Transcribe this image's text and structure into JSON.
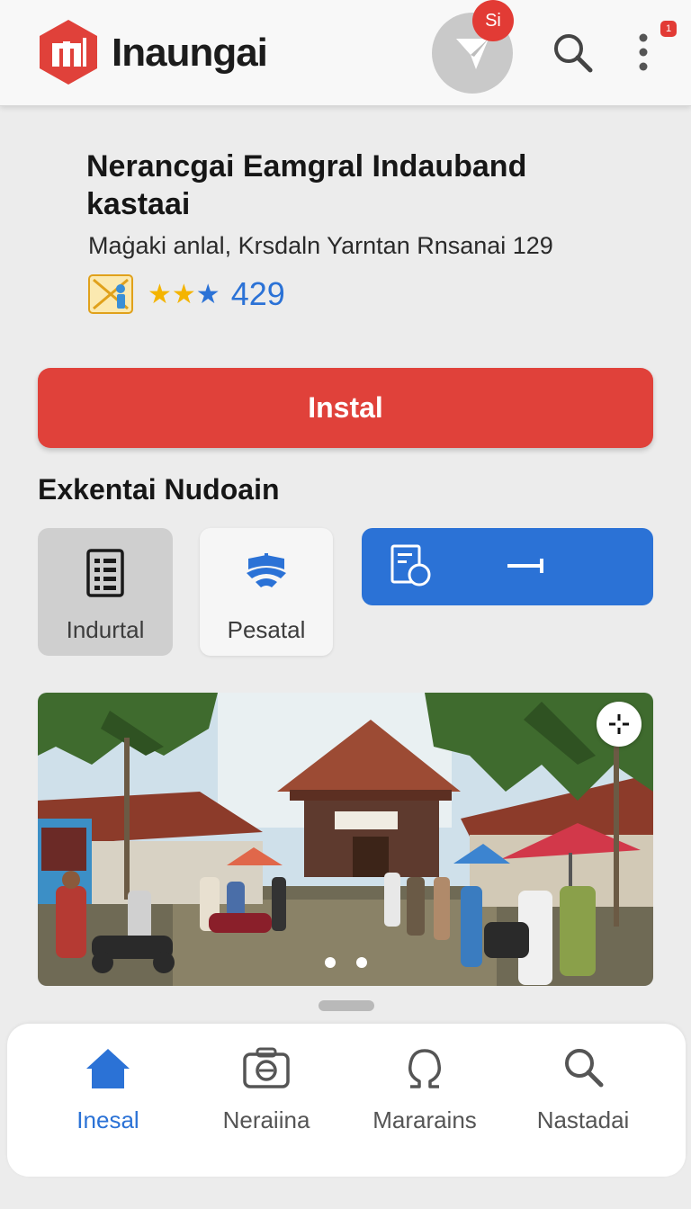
{
  "header": {
    "brand": "Inaungai",
    "avatar_badge": "Si",
    "menu_badge": "1"
  },
  "app": {
    "title": "Nerancgai Eamgral Indauband kastaai",
    "subtitle": "Maġaki anlal, Krsdaln Yarntan Rnsanai 129",
    "rating": "429"
  },
  "install_label": "Instal",
  "section": {
    "title": "Exkentai Nudoain",
    "chips": [
      {
        "label": "Indurtal",
        "icon": "document-list-icon"
      },
      {
        "label": "Pesatal",
        "icon": "wifi-shield-icon"
      },
      {
        "label": "",
        "icon": "form-search-icon"
      }
    ]
  },
  "bottom_nav": [
    {
      "label": "Inesal",
      "icon": "home-icon",
      "active": true
    },
    {
      "label": "Neraiina",
      "icon": "camera-icon",
      "active": false
    },
    {
      "label": "Mararains",
      "icon": "omega-icon",
      "active": false
    },
    {
      "label": "Nastadai",
      "icon": "search-icon",
      "active": false
    }
  ],
  "colors": {
    "accent_red": "#e0413a",
    "accent_blue": "#2b72d6",
    "star_gold": "#f4b400"
  }
}
